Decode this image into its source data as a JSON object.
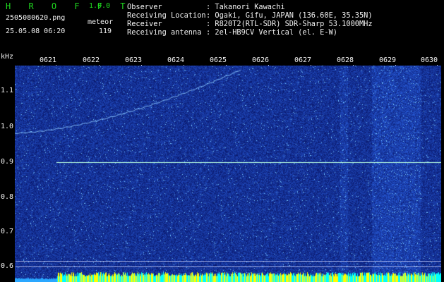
{
  "app": {
    "logo": "H R O F F T",
    "version": "1.0.0"
  },
  "file": {
    "name": "2505080620.png",
    "datetime": "25.05.08 06:20"
  },
  "meteor": {
    "label": "meteor",
    "count": "119"
  },
  "info": [
    {
      "key": "Observer",
      "value": ": Takanori Kawachi"
    },
    {
      "key": "Receiving Location",
      "value": ": Ogaki, Gifu, JAPAN (136.60E, 35.35N)"
    },
    {
      "key": "Receiver",
      "value": ": R820T2(RTL-SDR) SDR-Sharp 53.1000MHz"
    },
    {
      "key": "Receiving antenna",
      "value": ": 2el-HB9CV Vertical (el. E-W)"
    }
  ],
  "axis": {
    "unit": "kHz",
    "x_ticks": [
      "0621",
      "0622",
      "0623",
      "0624",
      "0625",
      "0626",
      "0627",
      "0628",
      "0629",
      "0630"
    ],
    "y_ticks": [
      "1.1",
      "1.0",
      "0.9",
      "0.8",
      "0.7",
      "0.6"
    ]
  },
  "colors": {
    "trace_green": "#1fd81f",
    "background": "#0a1a78",
    "signal": "#9ff4ff",
    "level_bar": "#ffff00"
  }
}
